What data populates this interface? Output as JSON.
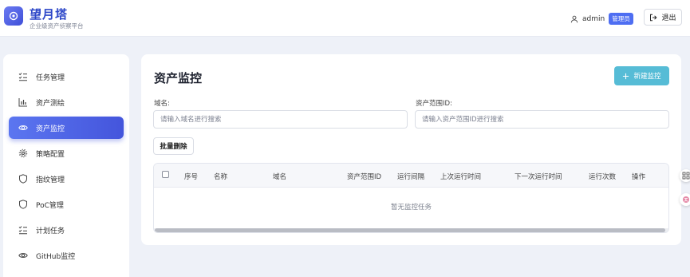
{
  "header": {
    "title": "望月塔",
    "subtitle": "企业级资产侦察平台",
    "username": "admin",
    "role_badge": "管理员",
    "logout_label": "退出"
  },
  "sidebar": {
    "items": [
      {
        "label": "任务管理",
        "icon": "task-list-icon"
      },
      {
        "label": "资产测绘",
        "icon": "bar-chart-icon"
      },
      {
        "label": "资产监控",
        "icon": "eye-icon",
        "active": true
      },
      {
        "label": "策略配置",
        "icon": "gear-icon"
      },
      {
        "label": "指纹管理",
        "icon": "shield-icon"
      },
      {
        "label": "PoC管理",
        "icon": "shield-icon"
      },
      {
        "label": "计划任务",
        "icon": "task-list-icon"
      },
      {
        "label": "GitHub监控",
        "icon": "eye-icon"
      }
    ]
  },
  "main": {
    "title": "资产监控",
    "new_button": "新建监控",
    "domain_label": "域名:",
    "domain_placeholder": "请输入域名进行搜索",
    "scope_label": "资产范围ID:",
    "scope_placeholder": "请输入资产范围ID进行搜索",
    "bulk_delete": "批量删除",
    "table": {
      "columns": [
        "序号",
        "名称",
        "域名",
        "资产范围ID",
        "运行间隔",
        "上次运行时间",
        "下一次运行时间",
        "运行次数",
        "操作"
      ],
      "empty_text": "暂无监控任务"
    }
  },
  "colors": {
    "brand": "#2d47c8",
    "active_nav": "#4f63e6",
    "new_button": "#56bcd6",
    "badge": "#4e6ef2"
  }
}
